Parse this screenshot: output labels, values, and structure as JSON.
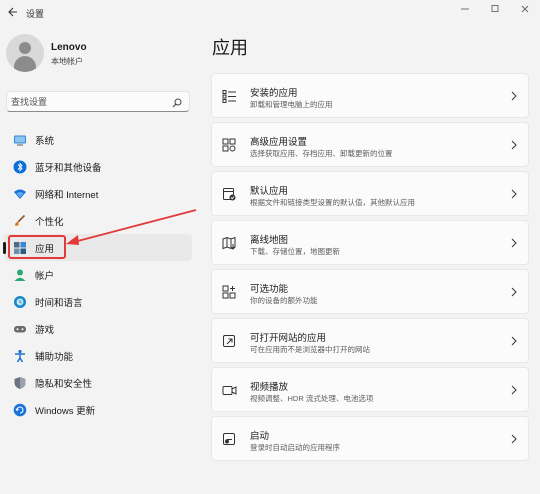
{
  "window": {
    "title": "设置",
    "controls": [
      "minimize-icon",
      "maximize-icon",
      "close-icon"
    ]
  },
  "user": {
    "name": "Lenovo",
    "account_type": "本地帐户"
  },
  "search": {
    "placeholder": "查找设置"
  },
  "sidebar": {
    "items": [
      {
        "label": "系统",
        "icon": "system-icon",
        "color": "#3a86d4"
      },
      {
        "label": "蓝牙和其他设备",
        "icon": "bluetooth-icon",
        "color": "#0b6fd6"
      },
      {
        "label": "网络和 Internet",
        "icon": "wifi-icon",
        "color": "#1a73d9"
      },
      {
        "label": "个性化",
        "icon": "brush-icon",
        "color": "#d67b1a"
      },
      {
        "label": "应用",
        "icon": "apps-icon",
        "color": "#4a6b8a",
        "active": true
      },
      {
        "label": "帐户",
        "icon": "account-icon",
        "color": "#2aa872"
      },
      {
        "label": "时间和语言",
        "icon": "globe-clock-icon",
        "color": "#1a86c8"
      },
      {
        "label": "游戏",
        "icon": "gamepad-icon",
        "color": "#6b6b6b"
      },
      {
        "label": "辅助功能",
        "icon": "accessibility-icon",
        "color": "#1a6fd0"
      },
      {
        "label": "隐私和安全性",
        "icon": "shield-icon",
        "color": "#6b7280"
      },
      {
        "label": "Windows 更新",
        "icon": "update-icon",
        "color": "#1a73d9"
      }
    ]
  },
  "main": {
    "title": "应用",
    "cards": [
      {
        "title": "安装的应用",
        "subtitle": "卸载和管理电脑上的应用",
        "icon": "installed-apps-icon"
      },
      {
        "title": "高级应用设置",
        "subtitle": "选择获取应用、存档应用、卸载更新的位置",
        "icon": "advanced-apps-icon"
      },
      {
        "title": "默认应用",
        "subtitle": "根据文件和链接类型设置的默认值，其他默认应用",
        "icon": "default-apps-icon"
      },
      {
        "title": "离线地图",
        "subtitle": "下载、存储位置，地图更新",
        "icon": "offline-maps-icon"
      },
      {
        "title": "可选功能",
        "subtitle": "你的设备的额外功能",
        "icon": "optional-features-icon"
      },
      {
        "title": "可打开网站的应用",
        "subtitle": "可在应用而不是浏览器中打开的网站",
        "icon": "apps-for-websites-icon"
      },
      {
        "title": "视频播放",
        "subtitle": "视频调整、HDR 流式处理、电池选项",
        "icon": "video-playback-icon"
      },
      {
        "title": "启动",
        "subtitle": "登录时自动启动的应用程序",
        "icon": "startup-icon"
      }
    ]
  },
  "annotation": {
    "color": "#e23a3a"
  }
}
